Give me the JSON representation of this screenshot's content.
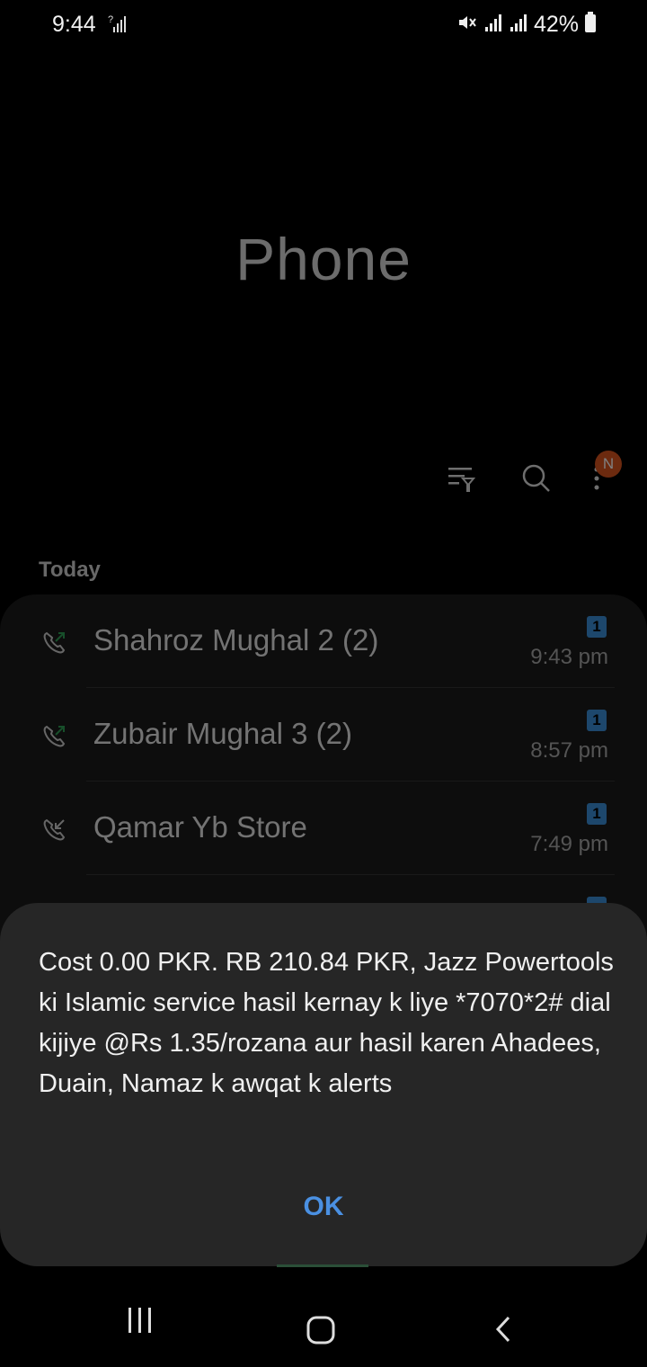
{
  "status_bar": {
    "time": "9:44",
    "battery": "42%"
  },
  "app": {
    "title": "Phone",
    "notification_badge": "N"
  },
  "call_log": {
    "section_label": "Today",
    "entries": [
      {
        "name": "Shahroz Mughal 2 (2)",
        "time": "9:43 pm",
        "sim": "1",
        "direction": "outgoing"
      },
      {
        "name": "Zubair Mughal 3 (2)",
        "time": "8:57 pm",
        "sim": "1",
        "direction": "outgoing"
      },
      {
        "name": "Qamar Yb Store",
        "time": "7:49 pm",
        "sim": "1",
        "direction": "incoming"
      }
    ]
  },
  "dialog": {
    "message": "Cost 0.00 PKR. RB 210.84 PKR, Jazz Powertools ki Islamic service hasil kernay k liye *7070*2# dial kijiye @Rs 1.35/rozana aur hasil karen Ahadees, Duain, Namaz k awqat k alerts",
    "ok_label": "OK"
  },
  "colors": {
    "accent": "#4a90e2",
    "badge": "#d9541e",
    "sim_badge": "#3a8fd8",
    "call_icon_green": "#2e9e55"
  },
  "icons": {
    "toolbar": [
      "filter-icon",
      "search-icon",
      "more-options-icon"
    ],
    "nav": [
      "recents-icon",
      "home-icon",
      "back-icon"
    ]
  }
}
